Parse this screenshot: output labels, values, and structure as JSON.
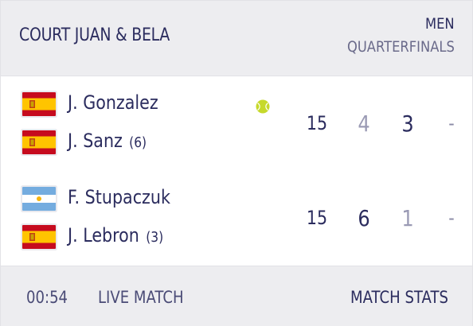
{
  "header": {
    "court": "COURT JUAN & BELA",
    "category": "MEN",
    "round": "QUARTERFINALS"
  },
  "teams": [
    {
      "players": [
        {
          "name": "J. Gonzalez",
          "seed": "",
          "flag": "spain-flag-icon"
        },
        {
          "name": "J. Sanz",
          "seed": "(6)",
          "flag": "spain-flag-icon"
        }
      ],
      "serving": true,
      "game_score": "15",
      "sets": [
        "4",
        "3",
        "-"
      ]
    },
    {
      "players": [
        {
          "name": "F. Stupaczuk",
          "seed": "",
          "flag": "argentina-flag-icon"
        },
        {
          "name": "J. Lebron",
          "seed": "(3)",
          "flag": "spain-flag-icon"
        }
      ],
      "serving": false,
      "game_score": "15",
      "sets": [
        "6",
        "1",
        "-"
      ]
    }
  ],
  "footer": {
    "time": "00:54",
    "status": "LIVE MATCH",
    "stats_link": "MATCH STATS"
  },
  "colors": {
    "primary_text": "#2b2c5e",
    "muted_text": "#9a9ab4",
    "panel_bg": "#ededf0",
    "serve_ball": "#c6d92b"
  }
}
